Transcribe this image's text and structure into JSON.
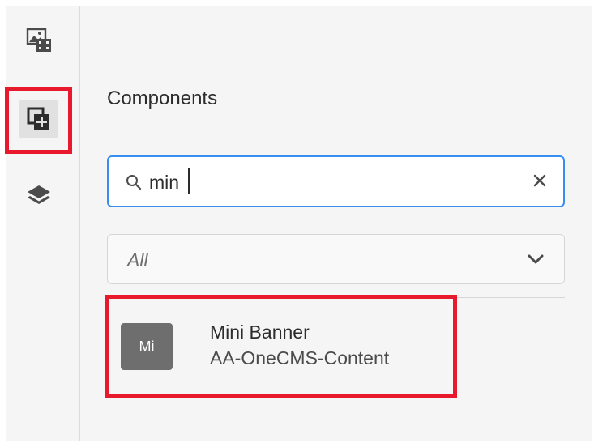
{
  "rail": {
    "items": [
      {
        "icon": "assets-icon",
        "active": false
      },
      {
        "icon": "components-icon",
        "active": true
      },
      {
        "icon": "layers-icon",
        "active": false
      }
    ]
  },
  "panel": {
    "title": "Components",
    "search": {
      "value": "min",
      "placeholder": ""
    },
    "filter": {
      "selected": "All"
    },
    "results": [
      {
        "avatar": "Mi",
        "name": "Mini Banner",
        "group": "AA-OneCMS-Content"
      }
    ]
  },
  "colors": {
    "highlight": "#e8192c",
    "focus_border": "#378ef0",
    "avatar_bg": "#6e6e6e"
  }
}
